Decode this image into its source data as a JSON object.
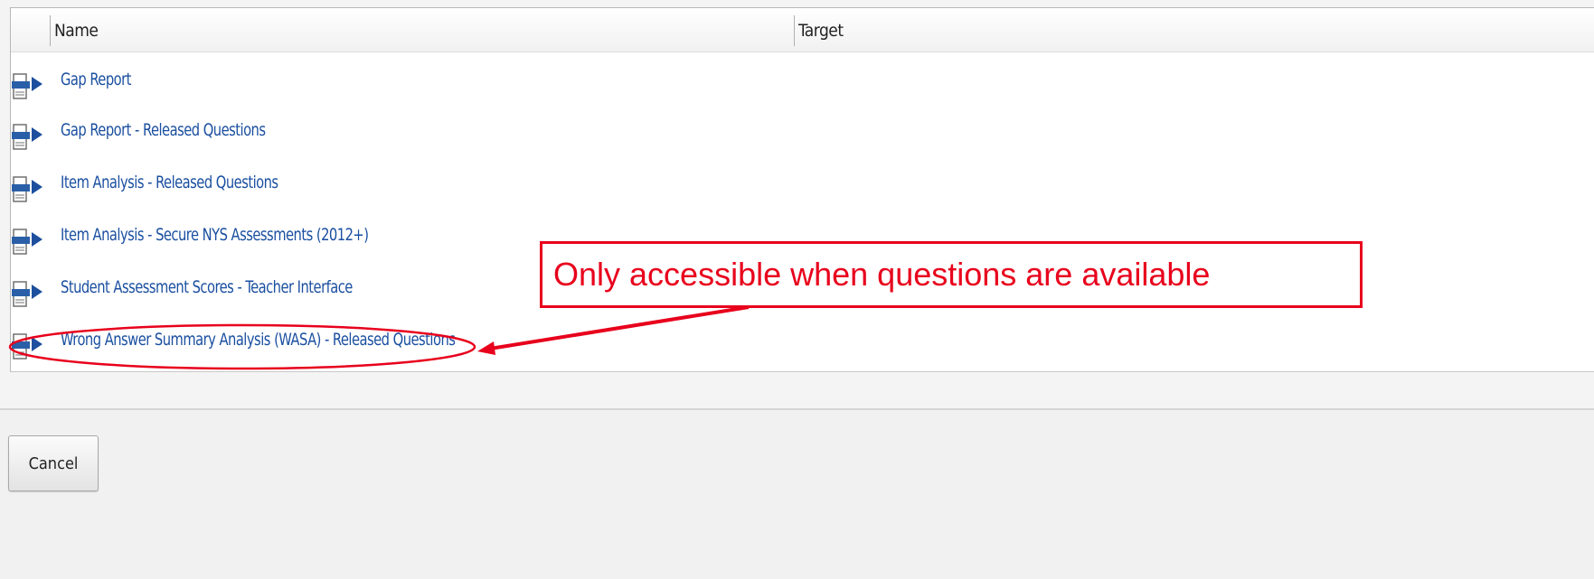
{
  "table": {
    "columns": [
      "Name",
      "Target"
    ],
    "rows": [
      {
        "label": "Gap Report",
        "icon": "html-report-icon"
      },
      {
        "label": "Gap Report - Released Questions",
        "icon": "html-report-icon"
      },
      {
        "label": "Item Analysis - Released Questions",
        "icon": "html-report-icon"
      },
      {
        "label": "Item Analysis - Secure NYS Assessments (2012+)",
        "icon": "html-report-icon"
      },
      {
        "label": "Student Assessment Scores - Teacher Interface",
        "icon": "html-report-icon"
      },
      {
        "label": "Wrong Answer Summary Analysis (WASA) - Released Questions",
        "icon": "html-report-icon"
      }
    ]
  },
  "footer": {
    "cancel_label": "Cancel"
  },
  "annotation": {
    "callout_text": "Only accessible when questions are available",
    "color": "#e8001c"
  },
  "colors": {
    "link": "#1a4fa0",
    "header_text": "#222222"
  }
}
